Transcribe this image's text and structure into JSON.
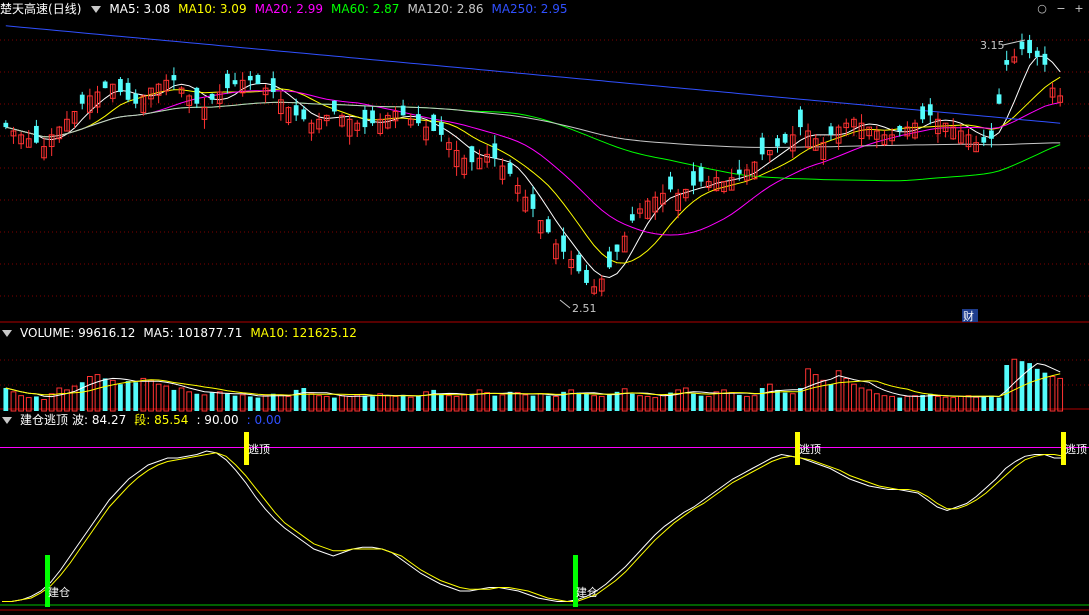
{
  "window_controls": {
    "circle_icon": "○",
    "minus_icon": "−",
    "plus_icon": "+"
  },
  "main_header": {
    "stock_name": "楚天高速",
    "period": "(日线)",
    "indicators": [
      {
        "label": "MA5: 3.08",
        "color": "#ffffff"
      },
      {
        "label": "MA10: 3.09",
        "color": "#ffff00"
      },
      {
        "label": "MA20: 2.99",
        "color": "#ff00ff"
      },
      {
        "label": "MA60: 2.87",
        "color": "#00ff00"
      },
      {
        "label": "MA120: 2.86",
        "color": "#c8c8c8"
      },
      {
        "label": "MA250: 2.95",
        "color": "#3050ff"
      }
    ]
  },
  "volume_header": {
    "items": [
      {
        "label": "VOLUME: 99616.12",
        "color": "#ffffff"
      },
      {
        "label": "MA5: 101877.71",
        "color": "#ffffff"
      },
      {
        "label": "MA10: 121625.12",
        "color": "#ffff00"
      }
    ]
  },
  "signal_header": {
    "title": "建仓逃顶",
    "items": [
      {
        "label": "波: 84.27",
        "color": "#ffffff"
      },
      {
        "label": "段: 85.54",
        "color": "#ffff00"
      },
      {
        "label": ": 90.00",
        "color": "#ffffff"
      },
      {
        "label": ": 0.00",
        "color": "#3050ff"
      }
    ]
  },
  "annotations": {
    "high_label": "3.15",
    "low_label": "2.51",
    "finance_badge": "财",
    "buy_label": "建仓",
    "sell_label": "逃顶"
  },
  "colors": {
    "up": "#ff3232",
    "down": "#54fcfc",
    "grid": "#800000",
    "panel_line": "#b00000"
  },
  "chart_data": {
    "type": "candlestick",
    "price": {
      "ylim": [
        2.45,
        3.22
      ],
      "high": 3.15,
      "low": 2.51,
      "closes": [
        2.94,
        2.93,
        2.92,
        2.91,
        2.9,
        2.89,
        2.92,
        2.94,
        2.96,
        2.98,
        3.0,
        3.02,
        3.03,
        3.04,
        3.05,
        3.03,
        3.01,
        3.0,
        3.02,
        3.04,
        3.05,
        3.06,
        3.06,
        3.04,
        3.02,
        3.0,
        2.99,
        3.01,
        3.03,
        3.04,
        3.05,
        3.06,
        3.06,
        3.05,
        3.04,
        3.03,
        3.01,
        2.99,
        2.97,
        2.96,
        2.95,
        2.96,
        2.97,
        2.98,
        2.97,
        2.96,
        2.95,
        2.94,
        2.95,
        2.96,
        2.97,
        2.98,
        2.97,
        2.96,
        2.95,
        2.94,
        2.93,
        2.92,
        2.9,
        2.88,
        2.86,
        2.85,
        2.86,
        2.87,
        2.86,
        2.84,
        2.82,
        2.79,
        2.76,
        2.73,
        2.7,
        2.67,
        2.64,
        2.62,
        2.6,
        2.57,
        2.54,
        2.53,
        2.55,
        2.58,
        2.62,
        2.66,
        2.7,
        2.73,
        2.75,
        2.76,
        2.77,
        2.78,
        2.77,
        2.78,
        2.79,
        2.8,
        2.8,
        2.81,
        2.8,
        2.81,
        2.82,
        2.83,
        2.85,
        2.87,
        2.88,
        2.89,
        2.9,
        2.92,
        2.94,
        2.93,
        2.91,
        2.9,
        2.92,
        2.94,
        2.95,
        2.96,
        2.95,
        2.94,
        2.93,
        2.92,
        2.92,
        2.93,
        2.94,
        2.95,
        2.96,
        2.97,
        2.96,
        2.95,
        2.94,
        2.93,
        2.92,
        2.9,
        2.9,
        2.91,
        3.0,
        3.1,
        3.12,
        3.14,
        3.13,
        3.12,
        3.1,
        3.04,
        3.02
      ]
    },
    "volume": {
      "ylim": [
        0,
        180000
      ],
      "values": [
        60000,
        50000,
        40000,
        35000,
        38000,
        30000,
        45000,
        60000,
        55000,
        65000,
        75000,
        90000,
        95000,
        85000,
        80000,
        70000,
        78000,
        75000,
        85000,
        80000,
        70000,
        65000,
        55000,
        60000,
        50000,
        45000,
        42000,
        48000,
        50000,
        45000,
        40000,
        42000,
        38000,
        35000,
        40000,
        45000,
        42000,
        38000,
        55000,
        60000,
        45000,
        40000,
        38000,
        35000,
        40000,
        38000,
        42000,
        40000,
        38000,
        45000,
        40000,
        38000,
        42000,
        36000,
        40000,
        50000,
        55000,
        45000,
        40000,
        38000,
        42000,
        45000,
        55000,
        48000,
        40000,
        42000,
        50000,
        48000,
        42000,
        40000,
        45000,
        40000,
        38000,
        50000,
        55000,
        48000,
        45000,
        40000,
        38000,
        42000,
        50000,
        58000,
        45000,
        40000,
        38000,
        35000,
        42000,
        48000,
        55000,
        60000,
        45000,
        40000,
        38000,
        50000,
        55000,
        48000,
        42000,
        38000,
        40000,
        60000,
        70000,
        55000,
        48000,
        45000,
        60000,
        110000,
        95000,
        80000,
        70000,
        105000,
        85000,
        70000,
        60000,
        55000,
        45000,
        40000,
        38000,
        35000,
        38000,
        40000,
        42000,
        45000,
        38000,
        36000,
        35000,
        38000,
        40000,
        36000,
        38000,
        40000,
        35000,
        120000,
        135000,
        130000,
        125000,
        110000,
        100000,
        90000,
        85000
      ]
    },
    "signal": {
      "ylim": [
        0,
        100
      ],
      "top_line": 90.0,
      "bottom_line": 0.0,
      "wave": [
        2,
        2,
        3,
        5,
        8,
        13,
        20,
        28,
        36,
        44,
        52,
        60,
        66,
        72,
        76,
        80,
        82,
        84,
        84,
        85,
        86,
        88,
        87,
        83,
        77,
        70,
        62,
        55,
        49,
        44,
        40,
        36,
        32,
        30,
        28,
        30,
        32,
        33,
        33,
        32,
        30,
        26,
        22,
        18,
        15,
        12,
        10,
        8,
        8,
        9,
        10,
        10,
        9,
        8,
        6,
        4,
        3,
        2,
        2,
        3,
        5,
        8,
        12,
        17,
        22,
        28,
        34,
        40,
        45,
        49,
        53,
        56,
        60,
        64,
        68,
        72,
        75,
        78,
        81,
        84,
        86,
        85,
        84,
        82,
        80,
        78,
        75,
        72,
        70,
        68,
        67,
        66,
        66,
        65,
        64,
        60,
        56,
        54,
        56,
        58,
        62,
        67,
        72,
        78,
        82,
        85,
        86,
        86,
        84,
        84
      ],
      "segment": [
        2,
        2,
        3,
        4,
        7,
        11,
        17,
        24,
        32,
        40,
        48,
        56,
        62,
        68,
        73,
        77,
        80,
        82,
        83,
        84,
        85,
        86,
        87,
        85,
        80,
        74,
        67,
        60,
        53,
        47,
        43,
        39,
        35,
        33,
        31,
        31,
        32,
        32,
        32,
        32,
        30,
        28,
        24,
        20,
        17,
        14,
        12,
        10,
        9,
        9,
        9,
        10,
        10,
        9,
        8,
        6,
        4,
        3,
        2,
        2,
        4,
        6,
        10,
        14,
        19,
        25,
        31,
        37,
        42,
        47,
        51,
        55,
        58,
        62,
        66,
        70,
        73,
        76,
        79,
        82,
        84,
        85,
        84,
        83,
        81,
        79,
        77,
        74,
        72,
        70,
        68,
        67,
        66,
        66,
        65,
        62,
        58,
        55,
        55,
        57,
        60,
        64,
        69,
        74,
        79,
        83,
        85,
        86,
        86,
        85
      ]
    }
  }
}
